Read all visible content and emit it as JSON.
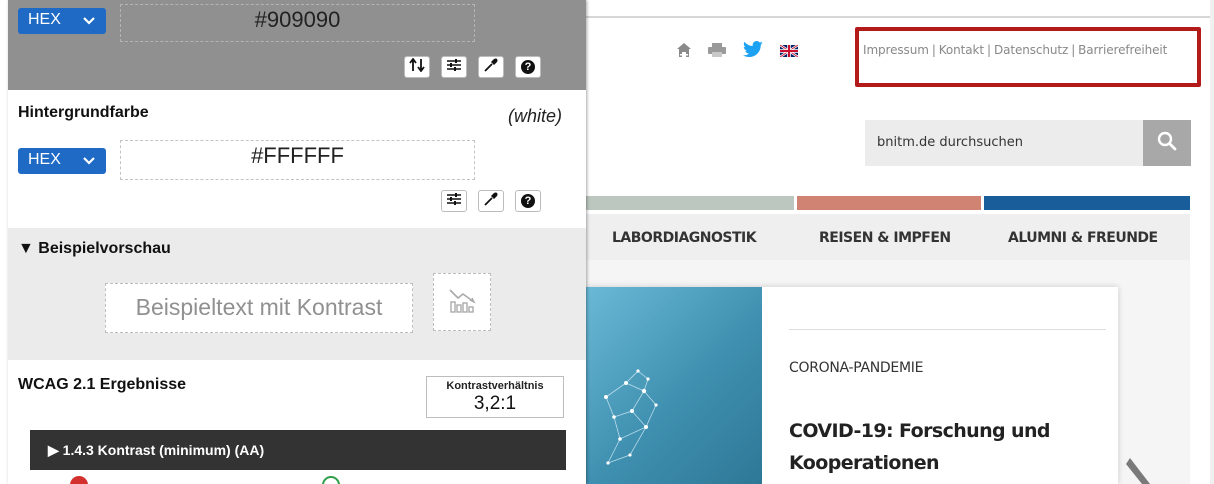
{
  "checker": {
    "foreground": {
      "format": "HEX",
      "value": "#909090"
    },
    "background": {
      "label": "Hintergrundfarbe",
      "color_name": "(white)",
      "format": "HEX",
      "value": "#FFFFFF"
    },
    "preview": {
      "heading": "▼ Beispielvorschau",
      "sample_text": "Beispieltext mit Kontrast"
    },
    "results": {
      "heading": "WCAG 2.1 Ergebnisse",
      "ratio_label": "Kontrastverhältnis",
      "ratio_value": "3,2:1",
      "criterion": "▶ 1.4.3 Kontrast (minimum) (AA)"
    },
    "tool_help_glyph": "?"
  },
  "site": {
    "meta_links": [
      "Impressum",
      "Kontakt",
      "Datenschutz",
      "Barrierefreiheit"
    ],
    "meta_separator": "|",
    "search_placeholder": "bnitm.de durchsuchen",
    "nav": [
      "LABORDIAGNOSTIK",
      "REISEN & IMPFEN",
      "ALUMNI & FREUNDE"
    ],
    "news": {
      "kicker": "CORONA-PANDEMIE",
      "title": "COVID-19: Forschung und Kooperationen"
    }
  },
  "colors": {
    "foreground": "#909090",
    "background": "#FFFFFF",
    "accent_select": "#1f6ac5",
    "highlight_border": "#b31b1b",
    "fail": "#d32f2f",
    "pass": "#2e9e4b",
    "strip_green": "#bcc7bf",
    "strip_red": "#d18373",
    "strip_blue": "#195d9b"
  },
  "icons": [
    "chevron-down-icon",
    "swap-icon",
    "sliders-icon",
    "eyedropper-icon",
    "help-icon",
    "chart-icon",
    "home-icon",
    "print-icon",
    "twitter-icon",
    "uk-flag-icon",
    "search-icon",
    "next-arrow-icon"
  ]
}
